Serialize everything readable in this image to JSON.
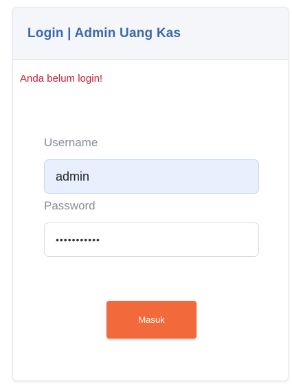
{
  "header": {
    "title": "Login | Admin Uang Kas"
  },
  "alert": {
    "message": "Anda belum login!",
    "color": "#cc2030"
  },
  "form": {
    "username_label": "Username",
    "username_value": "admin",
    "password_label": "Password",
    "password_value": "•••••••••••",
    "submit_label": "Masuk"
  },
  "colors": {
    "title": "#3c67ad",
    "button": "#f26a3c",
    "username_autofill_bg": "#e8f0fe"
  }
}
